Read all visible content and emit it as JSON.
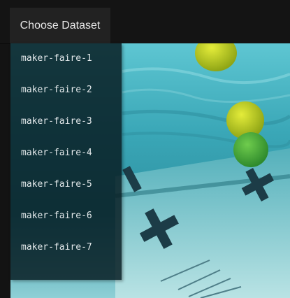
{
  "header": {
    "choose_dataset_label": "Choose Dataset"
  },
  "dataset_menu": {
    "items": [
      {
        "label": "maker-faire-1"
      },
      {
        "label": "maker-faire-2"
      },
      {
        "label": "maker-faire-3"
      },
      {
        "label": "maker-faire-4"
      },
      {
        "label": "maker-faire-5"
      },
      {
        "label": "maker-faire-6"
      },
      {
        "label": "maker-faire-7"
      }
    ]
  },
  "colors": {
    "page_background": "#131313",
    "button_background": "#222222",
    "menu_background": "#081e24",
    "pool_water": "#3a9fae",
    "ball_yellow": "#c7d81c",
    "ball_green": "#4fb33a"
  }
}
